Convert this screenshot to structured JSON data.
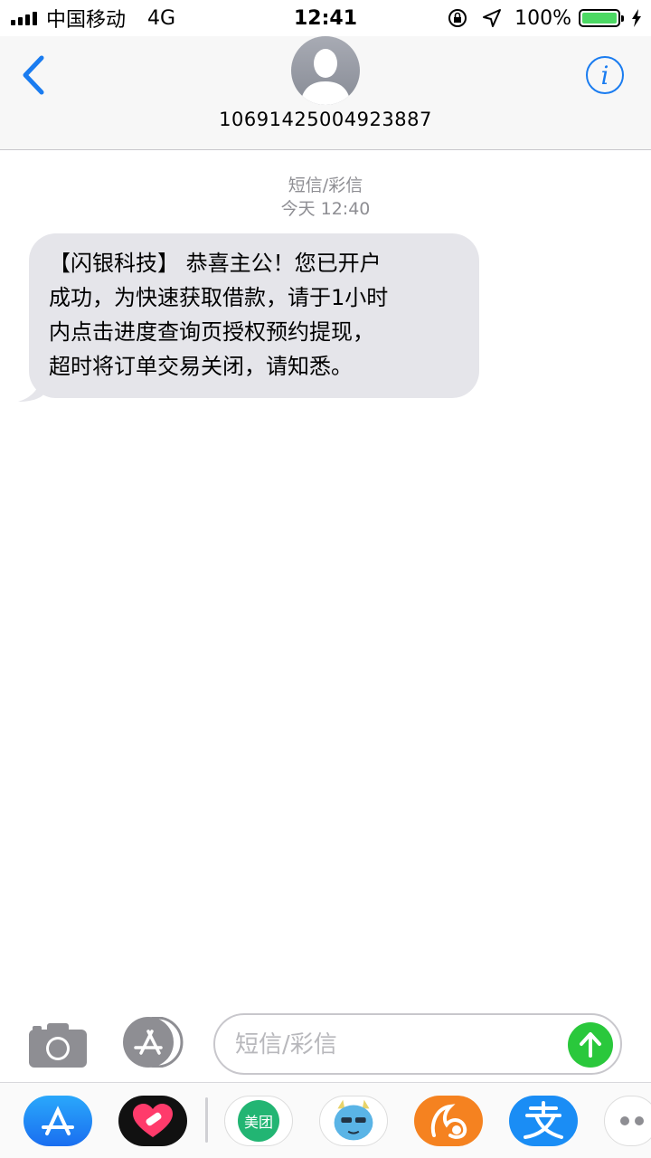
{
  "status_bar": {
    "carrier": "中国移动",
    "network": "4G",
    "time": "12:41",
    "battery_percent": "100%",
    "battery_level": 1.0,
    "icons": [
      "signal-icon",
      "orientation-lock-icon",
      "location-icon",
      "battery-icon",
      "charging-icon"
    ]
  },
  "header": {
    "sender": "10691425004923887",
    "icons": [
      "back-chevron-icon",
      "contact-avatar-icon",
      "info-icon"
    ]
  },
  "conversation": {
    "type_label": "短信/彩信",
    "timestamp": "今天 12:40",
    "messages": [
      {
        "direction": "incoming",
        "lines": [
          "【闪银科技】 恭喜主公！您已开户",
          "成功，为快速获取借款，请于1小时",
          "内点击进度查询页授权预约提现，",
          "超时将订单交易关闭，请知悉。"
        ]
      }
    ]
  },
  "input_bar": {
    "placeholder": "短信/彩信",
    "icons": [
      "camera-icon",
      "app-store-icon",
      "send-arrow-icon"
    ]
  },
  "app_strip": {
    "apps": [
      {
        "name": "app-store",
        "color": "#1a8df5"
      },
      {
        "name": "digital-touch",
        "color": "#111111"
      },
      {
        "name": "meituan",
        "label": "美团",
        "color": "#22b573"
      },
      {
        "name": "sticker",
        "color": "#5ab4e6"
      },
      {
        "name": "uc-browser",
        "color": "#f58220"
      },
      {
        "name": "alipay",
        "color": "#1a8df5"
      },
      {
        "name": "more-apps"
      }
    ]
  },
  "colors": {
    "accent": "#1a7cf0",
    "bubble_bg": "#e5e5ea",
    "send_green": "#2ac83c",
    "battery_green": "#4cd964"
  }
}
